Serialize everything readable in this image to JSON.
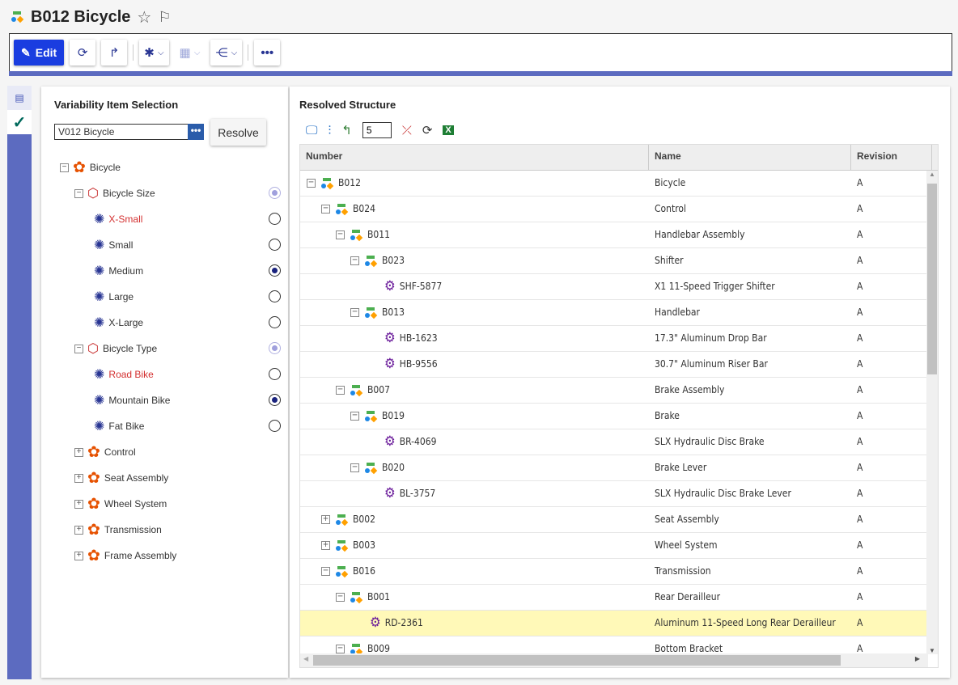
{
  "header": {
    "title": "B012 Bicycle",
    "icon": "assembly-icon"
  },
  "toolbar": {
    "edit_label": "Edit",
    "more": "•••"
  },
  "left": {
    "title": "Variability Item Selection",
    "variant_value": "V012 Bicycle",
    "browse": "•••",
    "resolve_label": "Resolve",
    "tree": [
      {
        "label": "Bicycle",
        "level": 0,
        "exp": "−",
        "kind": "root"
      },
      {
        "label": "Bicycle Size",
        "level": 1,
        "exp": "−",
        "kind": "group",
        "radio": "mixed"
      },
      {
        "label": "X-Small",
        "level": 2,
        "kind": "option",
        "radio": "off",
        "color": "#d32f2f"
      },
      {
        "label": "Small",
        "level": 2,
        "kind": "option",
        "radio": "off"
      },
      {
        "label": "Medium",
        "level": 2,
        "kind": "option",
        "radio": "on"
      },
      {
        "label": "Large",
        "level": 2,
        "kind": "option",
        "radio": "off"
      },
      {
        "label": "X-Large",
        "level": 2,
        "kind": "option",
        "radio": "off"
      },
      {
        "label": "Bicycle Type",
        "level": 1,
        "exp": "−",
        "kind": "group",
        "radio": "mixed"
      },
      {
        "label": "Road Bike",
        "level": 2,
        "kind": "option",
        "radio": "off",
        "color": "#d32f2f"
      },
      {
        "label": "Mountain Bike",
        "level": 2,
        "kind": "option",
        "radio": "on"
      },
      {
        "label": "Fat Bike",
        "level": 2,
        "kind": "option",
        "radio": "off"
      },
      {
        "label": "Control",
        "level": 1,
        "exp": "+",
        "kind": "root"
      },
      {
        "label": "Seat Assembly",
        "level": 1,
        "exp": "+",
        "kind": "root"
      },
      {
        "label": "Wheel System",
        "level": 1,
        "exp": "+",
        "kind": "root"
      },
      {
        "label": "Transmission",
        "level": 1,
        "exp": "+",
        "kind": "root"
      },
      {
        "label": "Frame Assembly",
        "level": 1,
        "exp": "+",
        "kind": "root"
      }
    ]
  },
  "right": {
    "title": "Resolved Structure",
    "levels": "5",
    "columns": [
      "Number",
      "Name",
      "Revision"
    ],
    "rows": [
      {
        "number": "B012",
        "name": "Bicycle",
        "rev": "A",
        "level": 0,
        "exp": "−",
        "type": "assembly"
      },
      {
        "number": "B024",
        "name": "Control",
        "rev": "A",
        "level": 1,
        "exp": "−",
        "type": "assembly"
      },
      {
        "number": "B011",
        "name": "Handlebar Assembly",
        "rev": "A",
        "level": 2,
        "exp": "−",
        "type": "assembly"
      },
      {
        "number": "B023",
        "name": "Shifter",
        "rev": "A",
        "level": 3,
        "exp": "−",
        "type": "assembly"
      },
      {
        "number": "SHF-5877",
        "name": "X1 11-Speed Trigger Shifter",
        "rev": "A",
        "level": 4,
        "type": "part"
      },
      {
        "number": "B013",
        "name": "Handlebar",
        "rev": "A",
        "level": 3,
        "exp": "−",
        "type": "assembly"
      },
      {
        "number": "HB-1623",
        "name": "17.3\" Aluminum Drop Bar",
        "rev": "A",
        "level": 4,
        "type": "part"
      },
      {
        "number": "HB-9556",
        "name": "30.7\" Aluminum Riser Bar",
        "rev": "A",
        "level": 4,
        "type": "part"
      },
      {
        "number": "B007",
        "name": "Brake Assembly",
        "rev": "A",
        "level": 2,
        "exp": "−",
        "type": "assembly"
      },
      {
        "number": "B019",
        "name": "Brake",
        "rev": "A",
        "level": 3,
        "exp": "−",
        "type": "assembly"
      },
      {
        "number": "BR-4069",
        "name": "SLX Hydraulic Disc Brake",
        "rev": "A",
        "level": 4,
        "type": "part"
      },
      {
        "number": "B020",
        "name": "Brake Lever",
        "rev": "A",
        "level": 3,
        "exp": "−",
        "type": "assembly"
      },
      {
        "number": "BL-3757",
        "name": "SLX Hydraulic Disc Brake Lever",
        "rev": "A",
        "level": 4,
        "type": "part"
      },
      {
        "number": "B002",
        "name": "Seat Assembly",
        "rev": "A",
        "level": 1,
        "exp": "+",
        "type": "assembly"
      },
      {
        "number": "B003",
        "name": "Wheel System",
        "rev": "A",
        "level": 1,
        "exp": "+",
        "type": "assembly"
      },
      {
        "number": "B016",
        "name": "Transmission",
        "rev": "A",
        "level": 1,
        "exp": "−",
        "type": "assembly"
      },
      {
        "number": "B001",
        "name": "Rear Derailleur",
        "rev": "A",
        "level": 2,
        "exp": "−",
        "type": "assembly"
      },
      {
        "number": "RD-2361",
        "name": "Aluminum 11-Speed Long Rear Derailleur",
        "rev": "A",
        "level": 3,
        "type": "part",
        "selected": true
      },
      {
        "number": "B009",
        "name": "Bottom Bracket",
        "rev": "A",
        "level": 2,
        "exp": "−",
        "type": "assembly"
      }
    ]
  }
}
